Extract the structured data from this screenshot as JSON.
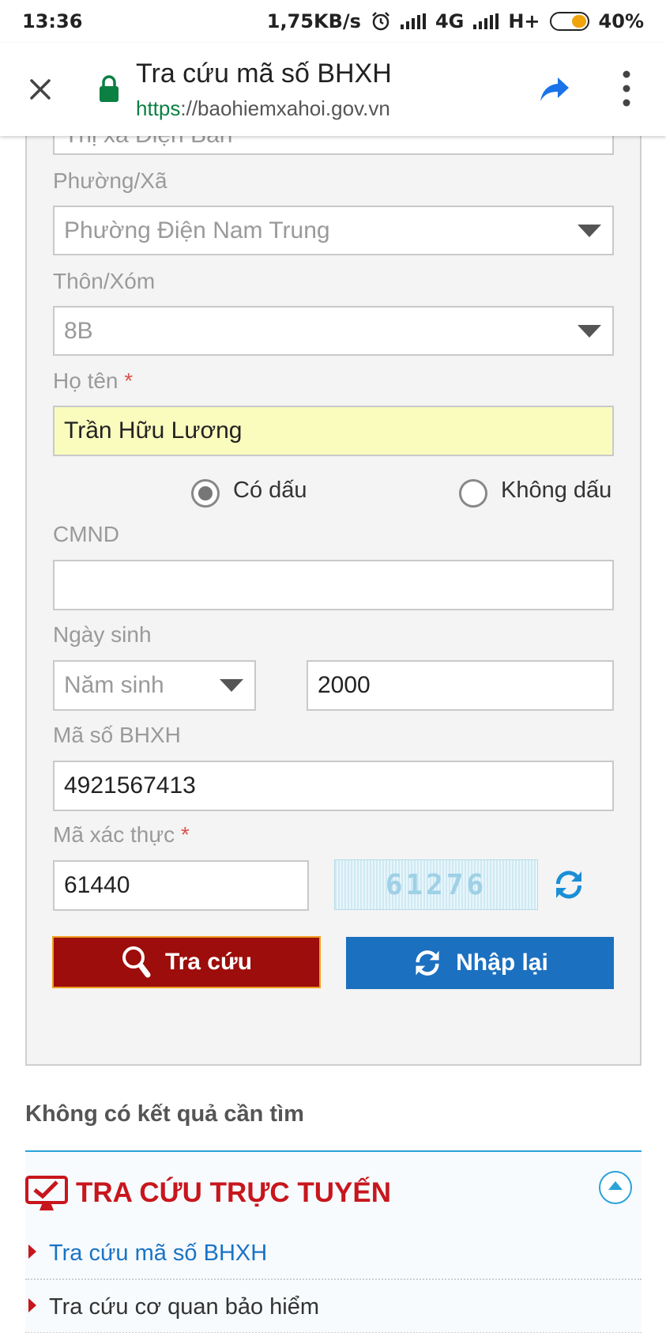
{
  "status_bar": {
    "time": "13:36",
    "network_speed": "1,75KB/s",
    "network_1": "4G",
    "network_2": "H+",
    "battery": "40%"
  },
  "browser": {
    "page_title": "Tra cứu mã số BHXH",
    "url_scheme": "https",
    "url_rest": "://baohiemxahoi.gov.vn",
    "icons": [
      "close-icon",
      "lock-icon",
      "share-icon",
      "more-menu-icon"
    ]
  },
  "form": {
    "prev_select_value": "Thị xã Điện Bàn",
    "ward": {
      "label": "Phường/Xã",
      "value": "Phường Điện Nam Trung"
    },
    "hamlet": {
      "label": "Thôn/Xóm",
      "value": "8B"
    },
    "full_name": {
      "label": "Họ tên",
      "required_mark": "*",
      "value": "Trần Hữu Lương"
    },
    "accent_options": {
      "with_accent": "Có dấu",
      "without_accent": "Không dấu",
      "selected": "Có dấu"
    },
    "id_card": {
      "label": "CMND",
      "value": ""
    },
    "dob": {
      "label": "Ngày sinh",
      "type_value": "Năm sinh",
      "year_value": "2000"
    },
    "bhxh_code": {
      "label": "Mã số BHXH",
      "value": "4921567413"
    },
    "captcha": {
      "label": "Mã xác thực",
      "required_mark": "*",
      "value": "61440",
      "image_text": "61276"
    },
    "search_button": "Tra cứu",
    "reset_button": "Nhập lại"
  },
  "result": {
    "message": "Không có kết quả cần tìm"
  },
  "online_lookup": {
    "heading": "TRA CỨU TRỰC TUYẾN",
    "links": [
      {
        "label": "Tra cứu mã số BHXH",
        "color": "#1a73c5"
      },
      {
        "label": "Tra cứu cơ quan bảo hiểm",
        "color": "#333333"
      }
    ]
  },
  "colors": {
    "search_button": "#9c0d0b",
    "reset_button": "#1c70c0",
    "heading_red": "#c8161d",
    "accent_blue": "#2aa3d8",
    "name_field_highlight": "#fafcbe"
  }
}
